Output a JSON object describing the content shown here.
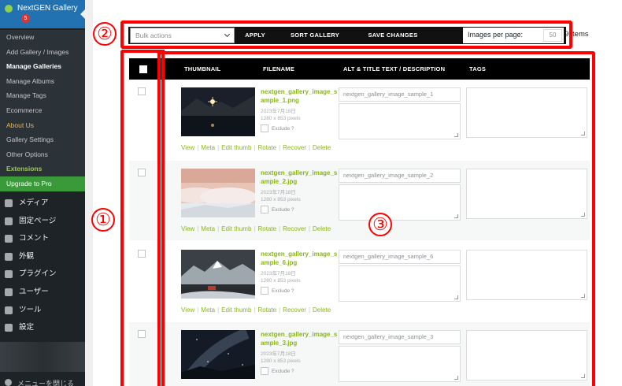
{
  "sidebar": {
    "plugin_title": "NextGEN Gallery",
    "plugin_badge": "5",
    "submenu": [
      {
        "label": "Overview",
        "style": "normal"
      },
      {
        "label": "Add Gallery / Images",
        "style": "normal"
      },
      {
        "label": "Manage Galleries",
        "style": "current"
      },
      {
        "label": "Manage Albums",
        "style": "normal"
      },
      {
        "label": "Manage Tags",
        "style": "normal"
      },
      {
        "label": "Ecommerce",
        "style": "normal"
      },
      {
        "label": "About Us",
        "style": "orange"
      },
      {
        "label": "Gallery Settings",
        "style": "normal"
      },
      {
        "label": "Other Options",
        "style": "normal"
      },
      {
        "label": "Extensions",
        "style": "green-text"
      },
      {
        "label": "Upgrade to Pro",
        "style": "green-bg"
      }
    ],
    "wp_menu": [
      {
        "label": "メディア",
        "icon": "media-icon"
      },
      {
        "label": "固定ページ",
        "icon": "pages-icon"
      },
      {
        "label": "コメント",
        "icon": "comments-icon"
      },
      {
        "label": "外観",
        "icon": "appearance-icon"
      },
      {
        "label": "プラグイン",
        "icon": "plugins-icon"
      },
      {
        "label": "ユーザー",
        "icon": "users-icon"
      },
      {
        "label": "ツール",
        "icon": "tools-icon"
      },
      {
        "label": "設定",
        "icon": "settings-icon"
      }
    ],
    "collapse_label": "メニューを閉じる"
  },
  "annotations": [
    "①",
    "②",
    "③"
  ],
  "toolbar": {
    "bulk_actions": "Bulk actions",
    "apply": "APPLY",
    "sort_gallery": "SORT GALLERY",
    "save_changes": "SAVE CHANGES",
    "images_per_page_label": "Images per page:",
    "images_per_page_value": "50",
    "items_count": "9 items"
  },
  "table": {
    "headers": {
      "thumbnail": "THUMBNAIL",
      "filename": "FILENAME",
      "alt_title": "ALT & TITLE TEXT / DESCRIPTION",
      "tags": "TAGS"
    },
    "exclude_label": "Exclude ?",
    "actions": [
      "View",
      "Meta",
      "Edit thumb",
      "Rotate",
      "Recover",
      "Delete"
    ],
    "rows": [
      {
        "filename": "nextgen_gallery_image_sample_1.png",
        "date": "2023年7月18日",
        "dims": "1280 x 853 pixels",
        "alt": "nextgen_gallery_image_sample_1",
        "thumb": "night-lake"
      },
      {
        "filename": "nextgen_gallery_image_sample_2.jpg",
        "date": "2023年7月18日",
        "dims": "1280 x 853 pixels",
        "alt": "nextgen_gallery_image_sample_2",
        "thumb": "sea-of-clouds"
      },
      {
        "filename": "nextgen_gallery_image_sample_6.jpg",
        "date": "2023年7月18日",
        "dims": "1280 x 853 pixels",
        "alt": "nextgen_gallery_image_sample_6",
        "thumb": "snow-mountain"
      },
      {
        "filename": "nextgen_gallery_image_sample_3.jpg",
        "date": "2023年7月18日",
        "dims": "1280 x 853 pixels",
        "alt": "nextgen_gallery_image_sample_3",
        "thumb": "milky-way"
      }
    ]
  },
  "colors": {
    "annotation_red": "#ff0000",
    "link_green": "#8ab51c",
    "sidebar_bg": "#1d2327",
    "plugin_blue": "#2271b1"
  }
}
